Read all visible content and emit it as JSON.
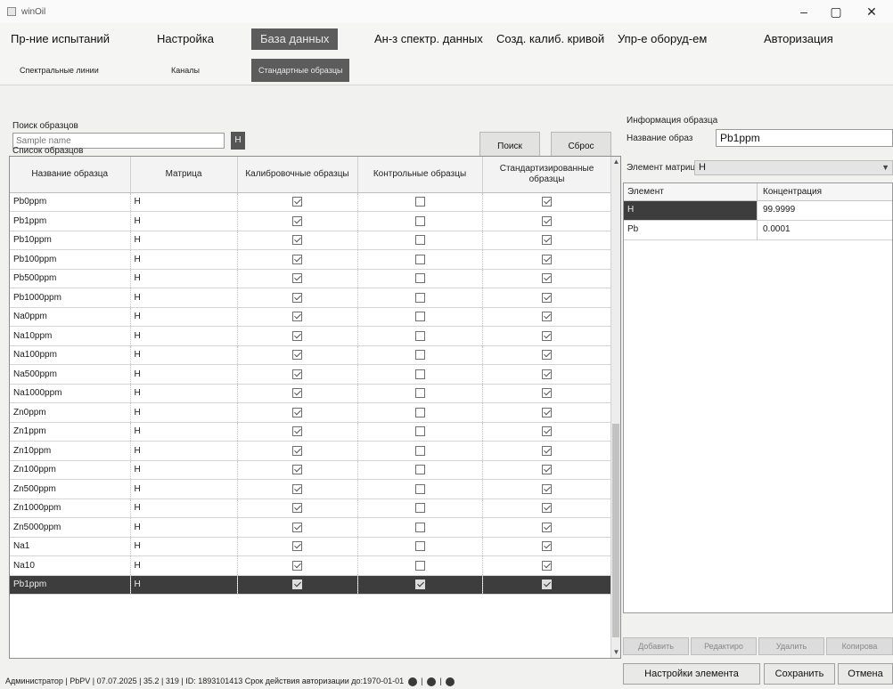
{
  "window": {
    "title": "winOil",
    "min": "–",
    "max": "▢",
    "close": "✕"
  },
  "menu": {
    "items": [
      "Пр-ние испытаний",
      "Настройка",
      "База данных",
      "Ан-з спектр. данных",
      "Созд. калиб. кривой",
      "Упр-е оборуд-ем",
      "Авторизация"
    ],
    "sub": [
      "Спектральные линии",
      "Каналы",
      "Стандартные образцы"
    ]
  },
  "search": {
    "label": "Поиск образцов",
    "placeholder": "Sample name",
    "h_button": "H",
    "search_button": "Поиск",
    "reset_button": "Сброс"
  },
  "samples": {
    "label": "Список образцов",
    "headers": [
      "Название образца",
      "Матрица",
      "Калибровочные образцы",
      "Контрольные образцы",
      "Стандартизированные образцы"
    ],
    "rows": [
      {
        "name": "Pb0ppm",
        "matrix": "H",
        "calib": true,
        "control": false,
        "std": true
      },
      {
        "name": "Pb1ppm",
        "matrix": "H",
        "calib": true,
        "control": false,
        "std": true
      },
      {
        "name": "Pb10ppm",
        "matrix": "H",
        "calib": true,
        "control": false,
        "std": true
      },
      {
        "name": "Pb100ppm",
        "matrix": "H",
        "calib": true,
        "control": false,
        "std": true
      },
      {
        "name": "Pb500ppm",
        "matrix": "H",
        "calib": true,
        "control": false,
        "std": true
      },
      {
        "name": "Pb1000ppm",
        "matrix": "H",
        "calib": true,
        "control": false,
        "std": true
      },
      {
        "name": "Na0ppm",
        "matrix": "H",
        "calib": true,
        "control": false,
        "std": true
      },
      {
        "name": "Na10ppm",
        "matrix": "H",
        "calib": true,
        "control": false,
        "std": true
      },
      {
        "name": "Na100ppm",
        "matrix": "H",
        "calib": true,
        "control": false,
        "std": true
      },
      {
        "name": "Na500ppm",
        "matrix": "H",
        "calib": true,
        "control": false,
        "std": true
      },
      {
        "name": "Na1000ppm",
        "matrix": "H",
        "calib": true,
        "control": false,
        "std": true
      },
      {
        "name": "Zn0ppm",
        "matrix": "H",
        "calib": true,
        "control": false,
        "std": true
      },
      {
        "name": "Zn1ppm",
        "matrix": "H",
        "calib": true,
        "control": false,
        "std": true
      },
      {
        "name": "Zn10ppm",
        "matrix": "H",
        "calib": true,
        "control": false,
        "std": true
      },
      {
        "name": "Zn100ppm",
        "matrix": "H",
        "calib": true,
        "control": false,
        "std": true
      },
      {
        "name": "Zn500ppm",
        "matrix": "H",
        "calib": true,
        "control": false,
        "std": true
      },
      {
        "name": "Zn1000ppm",
        "matrix": "H",
        "calib": true,
        "control": false,
        "std": true
      },
      {
        "name": "Zn5000ppm",
        "matrix": "H",
        "calib": true,
        "control": false,
        "std": true
      },
      {
        "name": "Na1",
        "matrix": "H",
        "calib": true,
        "control": false,
        "std": true
      },
      {
        "name": "Na10",
        "matrix": "H",
        "calib": true,
        "control": false,
        "std": true
      },
      {
        "name": "Pb1ppm",
        "matrix": "H",
        "calib": true,
        "control": true,
        "std": true,
        "selected": true
      }
    ]
  },
  "info": {
    "label": "Информация образца",
    "name_label": "Название образ",
    "name_value": "Pb1ppm",
    "matrix_label": "Элемент матриц",
    "matrix_value": "H",
    "headers": [
      "Элемент",
      "Концентрация"
    ],
    "rows": [
      {
        "element": "H",
        "conc": "99.9999"
      },
      {
        "element": "Pb",
        "conc": "0.0001"
      }
    ]
  },
  "actions": {
    "add": "Добавить",
    "edit": "Редактиро",
    "delete": "Удалить",
    "copy": "Копирова",
    "element_settings": "Настройки элемента",
    "save": "Сохранить",
    "cancel": "Отмена"
  },
  "status": {
    "text": "Администратор | PbPV | 07.07.2025 | 35.2 | 319 | ID: 1893101413 Срок действия авторизации до:1970-01-01"
  }
}
